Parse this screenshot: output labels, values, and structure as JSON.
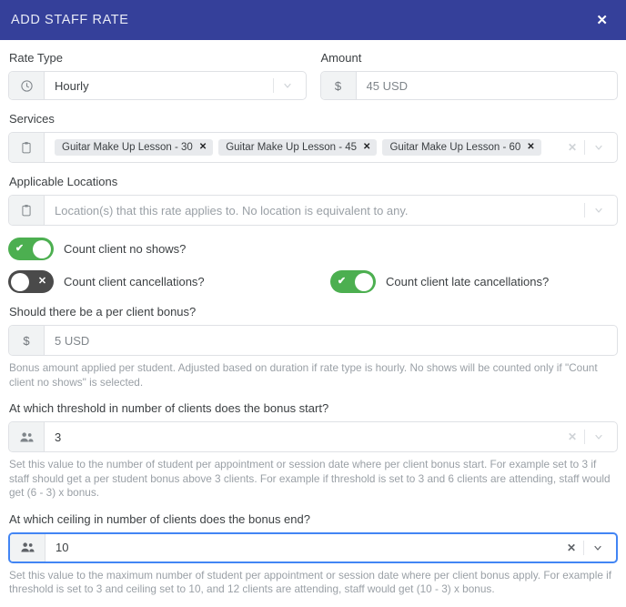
{
  "header": {
    "title": "ADD STAFF RATE",
    "close_label": "✕",
    "bg_color": "#35409a"
  },
  "colors": {
    "accent_green": "#4caf50",
    "toggle_off": "#4a4a4a",
    "focus_blue": "#4285f4",
    "chip_bg": "#e8eaed"
  },
  "rate_type": {
    "label": "Rate Type",
    "value": "Hourly",
    "icon": "clock-icon"
  },
  "amount": {
    "label": "Amount",
    "prefix": "$",
    "value": "45 USD"
  },
  "services": {
    "label": "Services",
    "icon": "clipboard-icon",
    "chips": [
      "Guitar Make Up Lesson - 30",
      "Guitar Make Up Lesson - 45",
      "Guitar Make Up Lesson - 60"
    ],
    "chip_remove_label": "✕",
    "clear_label": "✕"
  },
  "locations": {
    "label": "Applicable Locations",
    "icon": "clipboard-icon",
    "placeholder": "Location(s) that this rate applies to. No location is equivalent to any."
  },
  "toggles": [
    {
      "label": "Count client no shows?",
      "state": "on",
      "glyph": "✔"
    },
    {
      "label": "Count client cancellations?",
      "state": "off",
      "glyph": "✕"
    },
    {
      "label": "Count client late cancellations?",
      "state": "on",
      "glyph": "✔"
    }
  ],
  "bonus": {
    "label": "Should there be a per client bonus?",
    "prefix": "$",
    "value": "5 USD",
    "helper": "Bonus amount applied per student. Adjusted based on duration if rate type is hourly. No shows will be counted only if \"Count client no shows\" is selected."
  },
  "threshold": {
    "label": "At which threshold in number of clients does the bonus start?",
    "icon": "people-icon",
    "value": "3",
    "clear_label": "✕",
    "helper": "Set this value to the number of student per appointment or session date where per client bonus start. For example set to 3 if staff should get a per student bonus above 3 clients. For example if threshold is set to 3 and 6 clients are attending, staff would get (6 - 3) x bonus."
  },
  "ceiling": {
    "label": "At which ceiling in number of clients does the bonus end?",
    "icon": "people-icon",
    "value": "10",
    "clear_label": "✕",
    "focused": true,
    "helper": "Set this value to the maximum number of student per appointment or session date where per client bonus apply. For example if threshold is set to 3 and ceiling set to 10, and 12 clients are attending, staff would get (10 - 3) x bonus."
  }
}
